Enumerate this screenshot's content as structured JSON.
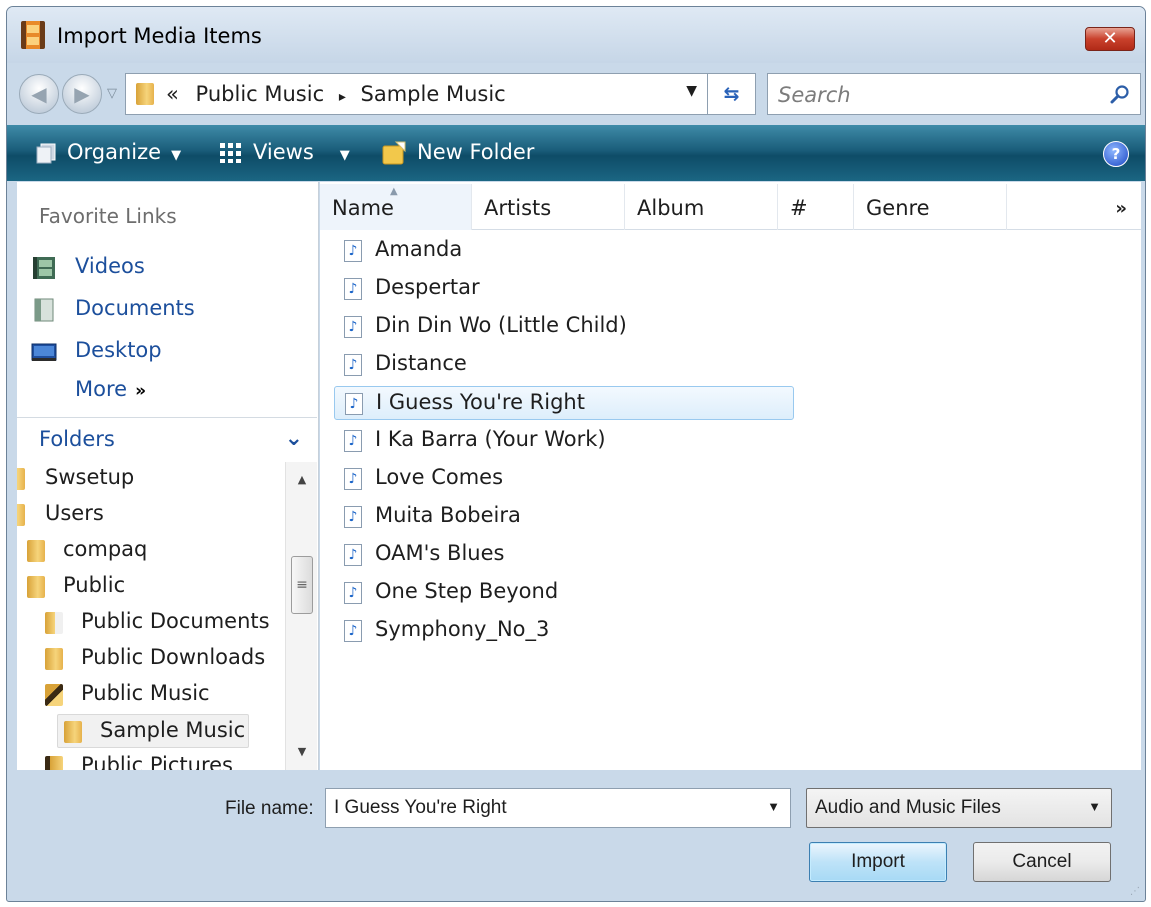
{
  "window": {
    "title": "Import Media Items",
    "close_glyph": "✕"
  },
  "nav": {
    "back_glyph": "◀",
    "forward_glyph": "▶",
    "recent_glyph": "▽",
    "breadcrumb_prefix": "«",
    "breadcrumb": [
      "Public Music",
      "Sample Music"
    ],
    "breadcrumb_sep": "▸",
    "dropdown_glyph": "▼",
    "refresh_glyph": "⇆",
    "search_placeholder": "Search"
  },
  "toolbar": {
    "organize_label": "Organize",
    "views_label": "Views",
    "new_folder_label": "New Folder",
    "caret": "▼",
    "help_glyph": "?"
  },
  "sidebar": {
    "favorite_header": "Favorite Links",
    "favorites": [
      {
        "label": "Videos",
        "icon": "videos-icon"
      },
      {
        "label": "Documents",
        "icon": "documents-icon"
      },
      {
        "label": "Desktop",
        "icon": "desktop-icon"
      }
    ],
    "more_label": "More",
    "more_glyph": "»",
    "folders_label": "Folders",
    "folders_chevron": "⌄",
    "tree": [
      {
        "label": "Swsetup",
        "icon": "folder-icon"
      },
      {
        "label": "Users",
        "icon": "folder-icon"
      },
      {
        "label": "compaq",
        "icon": "folder-icon"
      },
      {
        "label": "Public",
        "icon": "folder-icon"
      },
      {
        "label": "Public Documents",
        "icon": "documents-folder-icon"
      },
      {
        "label": "Public Downloads",
        "icon": "folder-icon"
      },
      {
        "label": "Public Music",
        "icon": "music-folder-icon"
      },
      {
        "label": "Sample Music",
        "icon": "folder-icon",
        "selected": true
      },
      {
        "label": "Public Pictures",
        "icon": "pictures-folder-icon"
      }
    ],
    "scroll_up_glyph": "▲",
    "scroll_down_glyph": "▼",
    "scroll_grip_glyph": "≡"
  },
  "file_list": {
    "columns": [
      "Name",
      "Artists",
      "Album",
      "#",
      "Genre"
    ],
    "more_columns_glyph": "»",
    "sort_glyph": "▲",
    "file_icon_glyph": "♪",
    "files": [
      {
        "name": "Amanda"
      },
      {
        "name": "Despertar"
      },
      {
        "name": "Din Din Wo (Little Child)"
      },
      {
        "name": "Distance"
      },
      {
        "name": "I Guess You're Right",
        "selected": true
      },
      {
        "name": "I Ka Barra (Your Work)"
      },
      {
        "name": "Love Comes"
      },
      {
        "name": "Muita Bobeira"
      },
      {
        "name": "OAM's Blues"
      },
      {
        "name": "One Step Beyond"
      },
      {
        "name": "Symphony_No_3"
      }
    ]
  },
  "footer": {
    "file_name_label": "File name:",
    "file_name_value": "I Guess You're Right",
    "dropdown_glyph": "▼",
    "file_type": "Audio and Music Files",
    "import_label": "Import",
    "cancel_label": "Cancel",
    "grip_glyph": "⋰"
  },
  "colors": {
    "toolbar": "#1a5d7a",
    "link": "#1c4f9c",
    "selection_border": "#99c9ef"
  }
}
